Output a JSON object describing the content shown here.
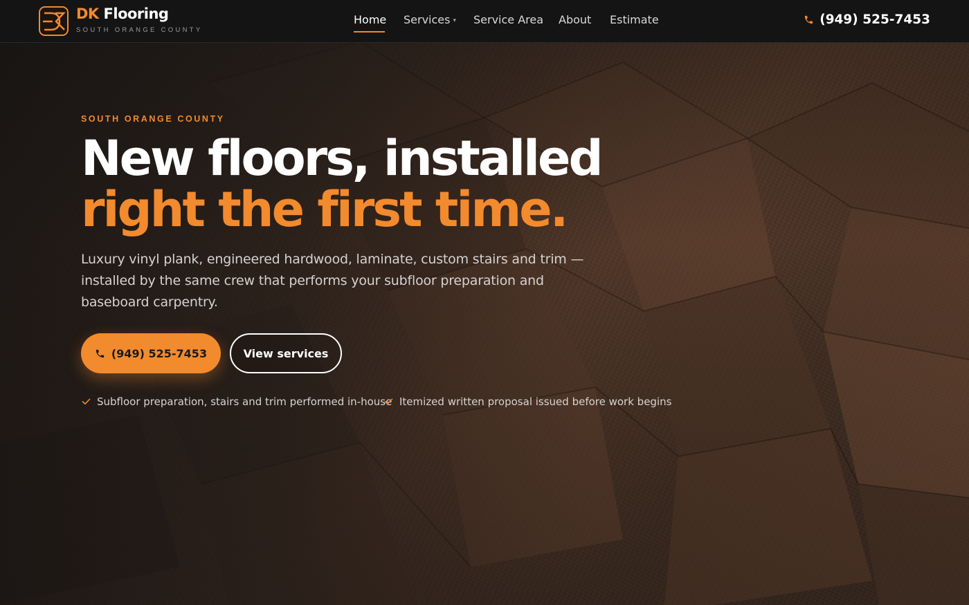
{
  "header": {
    "brand_accent": "DK",
    "brand_name": "Flooring",
    "brand_sub": "SOUTH ORANGE COUNTY",
    "logo_icon": "dk-monogram-icon",
    "nav": [
      {
        "label": "Home",
        "active": true
      },
      {
        "label": "Services",
        "has_dropdown": true
      },
      {
        "label": "Service Area"
      },
      {
        "label": "About"
      },
      {
        "label": "Estimate"
      }
    ],
    "services_caret": "▾",
    "phone": "(949) 525-7453",
    "phone_icon": "phone-icon"
  },
  "hero": {
    "eyebrow": "SOUTH ORANGE COUNTY",
    "headline_line1": "New floors, installed",
    "headline_line2": "right the first time.",
    "lede": "Luxury vinyl plank, engineered hardwood, laminate, custom stairs and trim — installed by the same crew that performs your subfloor preparation and baseboard carpentry.",
    "cta_call_label": "(949) 525-7453",
    "cta_services_label": "View services",
    "checks": [
      "Subfloor preparation, stairs and trim performed in-house",
      "Itemized written proposal issued before work begins"
    ],
    "check_icon": "checkmark-icon",
    "background": "parquet-wood-floor-image"
  },
  "colors": {
    "accent": "#f28a2e",
    "header_bg": "#141414",
    "text_light": "#ffffff",
    "text_muted": "#d6d2cf"
  }
}
